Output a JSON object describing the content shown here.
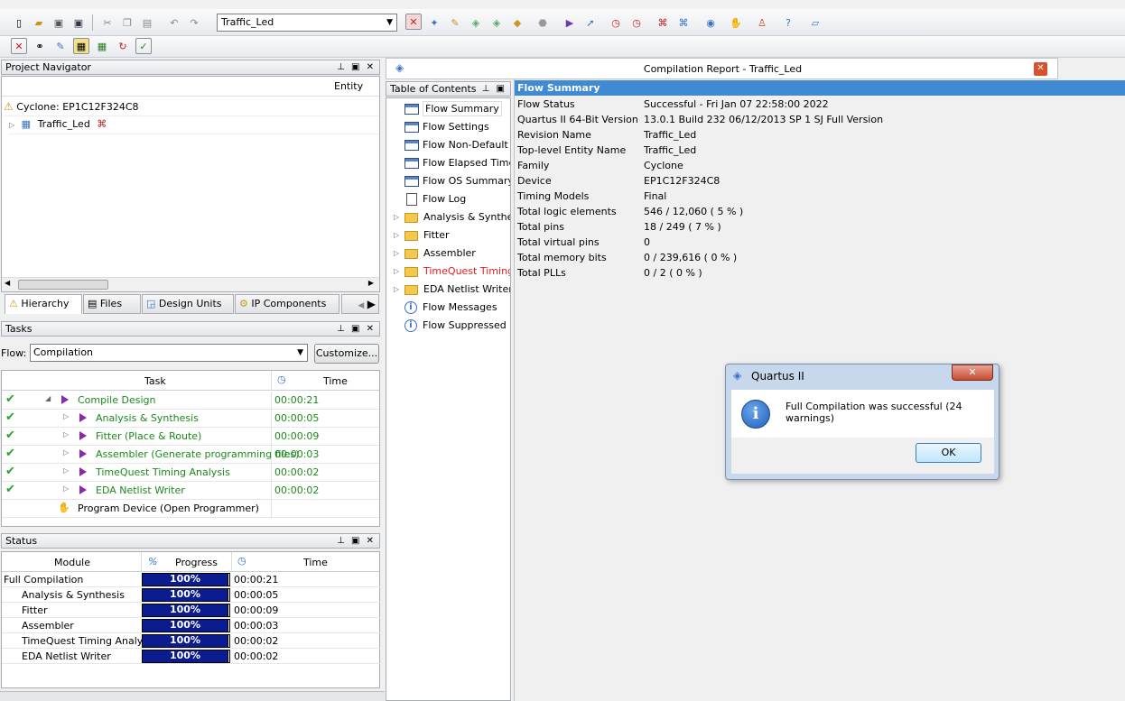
{
  "toolbar": {
    "entity_select": "Traffic_Led"
  },
  "project_navigator": {
    "title": "Project Navigator",
    "entity_header": "Entity",
    "device": "Cyclone: EP1C12F324C8",
    "top_entity": "Traffic_Led",
    "tabs": [
      "Hierarchy",
      "Files",
      "Design Units",
      "IP Components"
    ]
  },
  "tasks": {
    "title": "Tasks",
    "flow_label": "Flow:",
    "flow_value": "Compilation",
    "customize_label": "Customize...",
    "col_task": "Task",
    "col_time": "Time",
    "rows": [
      {
        "name": "Compile Design",
        "time": "00:00:21"
      },
      {
        "name": "Analysis & Synthesis",
        "time": "00:00:05"
      },
      {
        "name": "Fitter (Place & Route)",
        "time": "00:00:09"
      },
      {
        "name": "Assembler (Generate programming files)",
        "time": "00:00:03"
      },
      {
        "name": "TimeQuest Timing Analysis",
        "time": "00:00:02"
      },
      {
        "name": "EDA Netlist Writer",
        "time": "00:00:02"
      },
      {
        "name": "Program Device (Open Programmer)",
        "time": ""
      }
    ]
  },
  "status": {
    "title": "Status",
    "col_module": "Module",
    "col_pct": "%",
    "col_progress": "Progress",
    "col_time": "Time",
    "rows": [
      {
        "module": "Full Compilation",
        "progress": "100%",
        "time": "00:00:21"
      },
      {
        "module": "Analysis & Synthesis",
        "progress": "100%",
        "time": "00:00:05"
      },
      {
        "module": "Fitter",
        "progress": "100%",
        "time": "00:00:09"
      },
      {
        "module": "Assembler",
        "progress": "100%",
        "time": "00:00:03"
      },
      {
        "module": "TimeQuest Timing Analyzer",
        "progress": "100%",
        "time": "00:00:02"
      },
      {
        "module": "EDA Netlist Writer",
        "progress": "100%",
        "time": "00:00:02"
      }
    ]
  },
  "report": {
    "title": "Compilation Report - Traffic_Led",
    "toc_title": "Table of Contents",
    "toc_items": [
      "Flow Summary",
      "Flow Settings",
      "Flow Non-Default G",
      "Flow Elapsed Time",
      "Flow OS Summary",
      "Flow Log",
      "Analysis & Synthesi",
      "Fitter",
      "Assembler",
      "TimeQuest Timing A",
      "EDA Netlist Writer",
      "Flow Messages",
      "Flow Suppressed Me"
    ],
    "toc_error_color": "#e02020",
    "summary_header": "Flow Summary",
    "summary": [
      {
        "k": "Flow Status",
        "v": "Successful - Fri Jan 07 22:58:00 2022"
      },
      {
        "k": "Quartus II 64-Bit Version",
        "v": "13.0.1 Build 232 06/12/2013 SP 1 SJ Full Version"
      },
      {
        "k": "Revision Name",
        "v": "Traffic_Led"
      },
      {
        "k": "Top-level Entity Name",
        "v": "Traffic_Led"
      },
      {
        "k": "Family",
        "v": "Cyclone"
      },
      {
        "k": "Device",
        "v": "EP1C12F324C8"
      },
      {
        "k": "Timing Models",
        "v": "Final"
      },
      {
        "k": "Total logic elements",
        "v": "546 / 12,060 ( 5 % )"
      },
      {
        "k": "Total pins",
        "v": "18 / 249 ( 7 % )"
      },
      {
        "k": "Total virtual pins",
        "v": "0"
      },
      {
        "k": "Total memory bits",
        "v": "0 / 239,616 ( 0 % )"
      },
      {
        "k": "Total PLLs",
        "v": "0 / 2 ( 0 % )"
      }
    ]
  },
  "dialog": {
    "title": "Quartus II",
    "message": "Full Compilation was successful (24 warnings)",
    "ok_label": "OK"
  }
}
